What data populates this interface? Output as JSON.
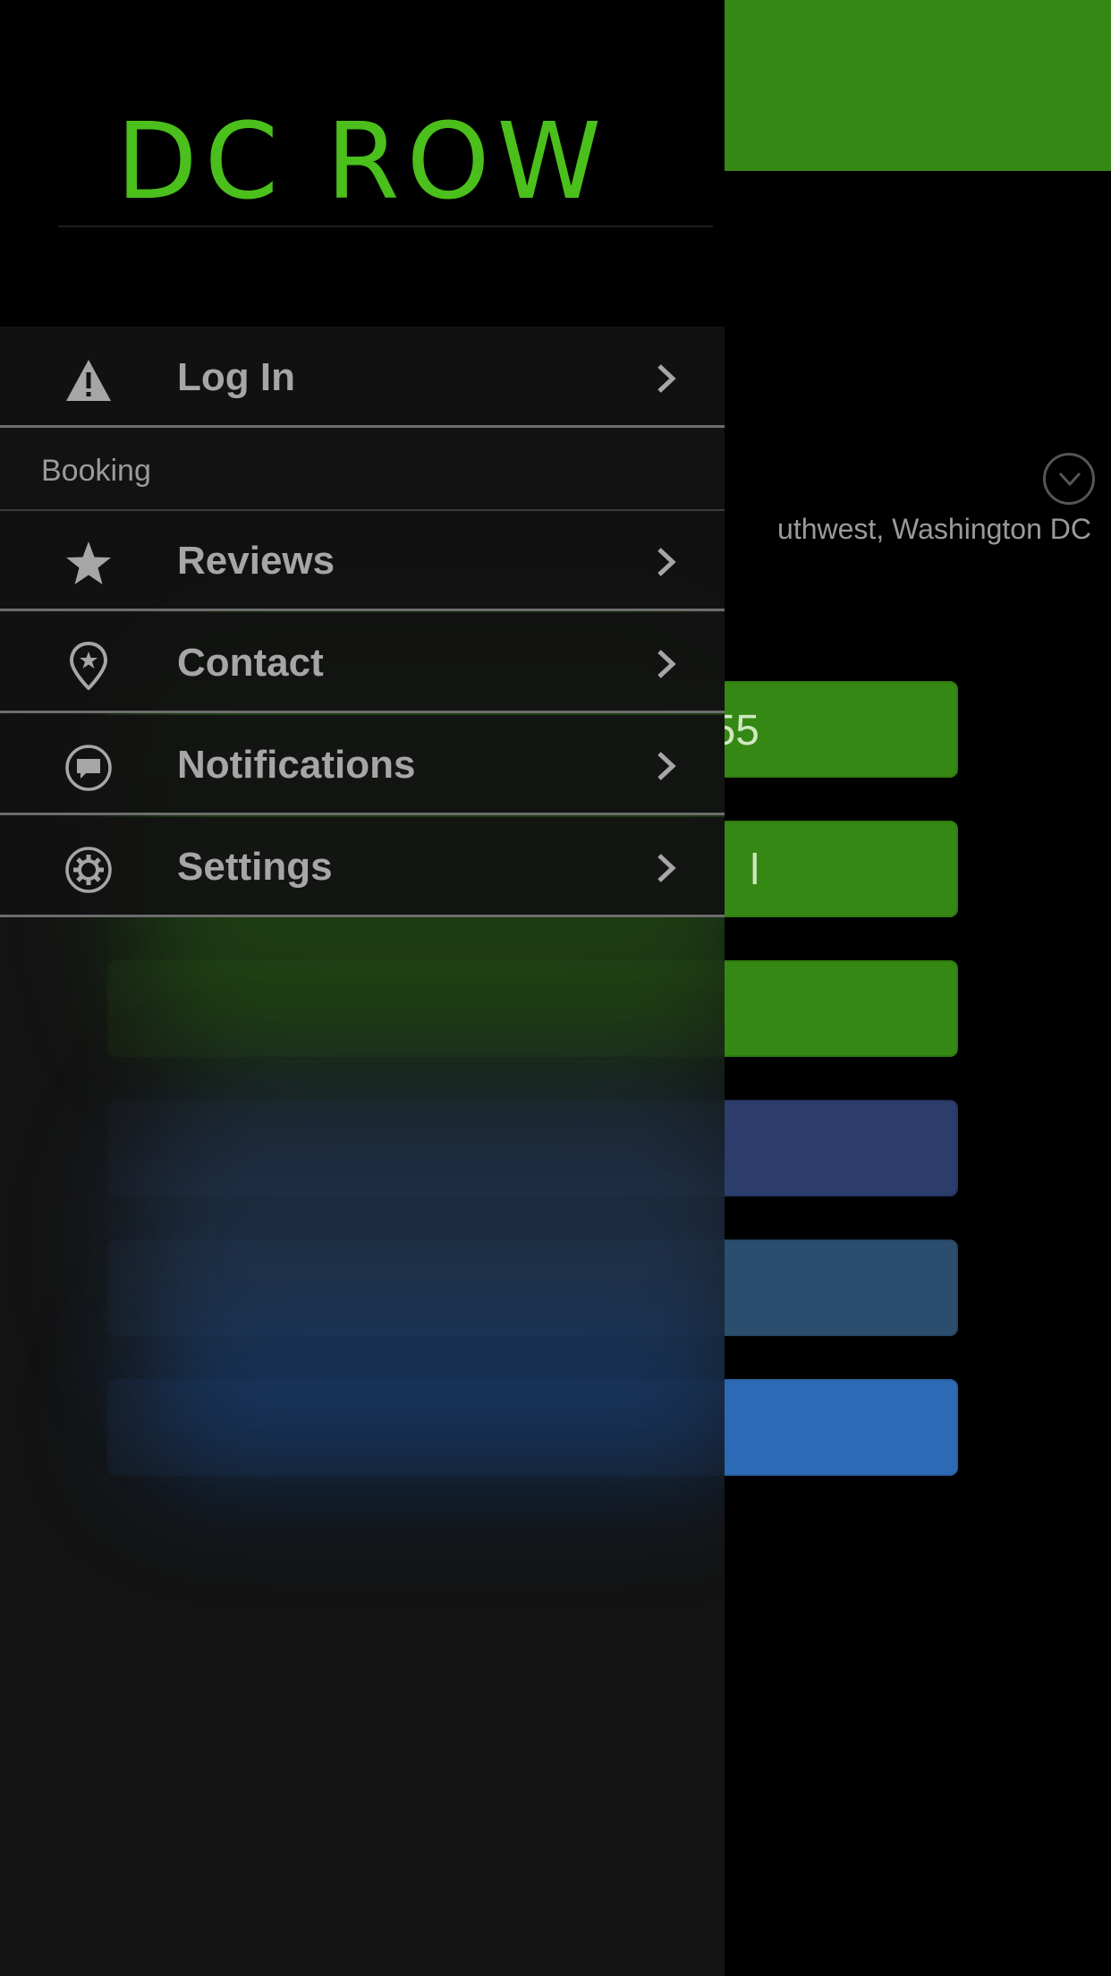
{
  "background": {
    "address": "uthwest, Washington DC",
    "buttons": [
      {
        "label": "55",
        "color": "#368814"
      },
      {
        "label": "l",
        "color": "#368814"
      },
      {
        "label": "",
        "color": "#368814"
      },
      {
        "label": "",
        "color": "#2c3d6b"
      },
      {
        "label": "",
        "color": "#2c4e6e"
      },
      {
        "label": "",
        "color": "#2d6ab5"
      }
    ],
    "header_color": "#368814"
  },
  "drawer": {
    "logo": "DC ROW",
    "logo_color": "#4bbf1c",
    "items": [
      {
        "label": "Log In",
        "icon": "warning-icon"
      },
      {
        "label": "Reviews",
        "icon": "star-icon"
      },
      {
        "label": "Contact",
        "icon": "location-pin-icon"
      },
      {
        "label": "Notifications",
        "icon": "chat-bubble-icon"
      },
      {
        "label": "Settings",
        "icon": "gear-icon"
      }
    ],
    "section_label": "Booking"
  }
}
